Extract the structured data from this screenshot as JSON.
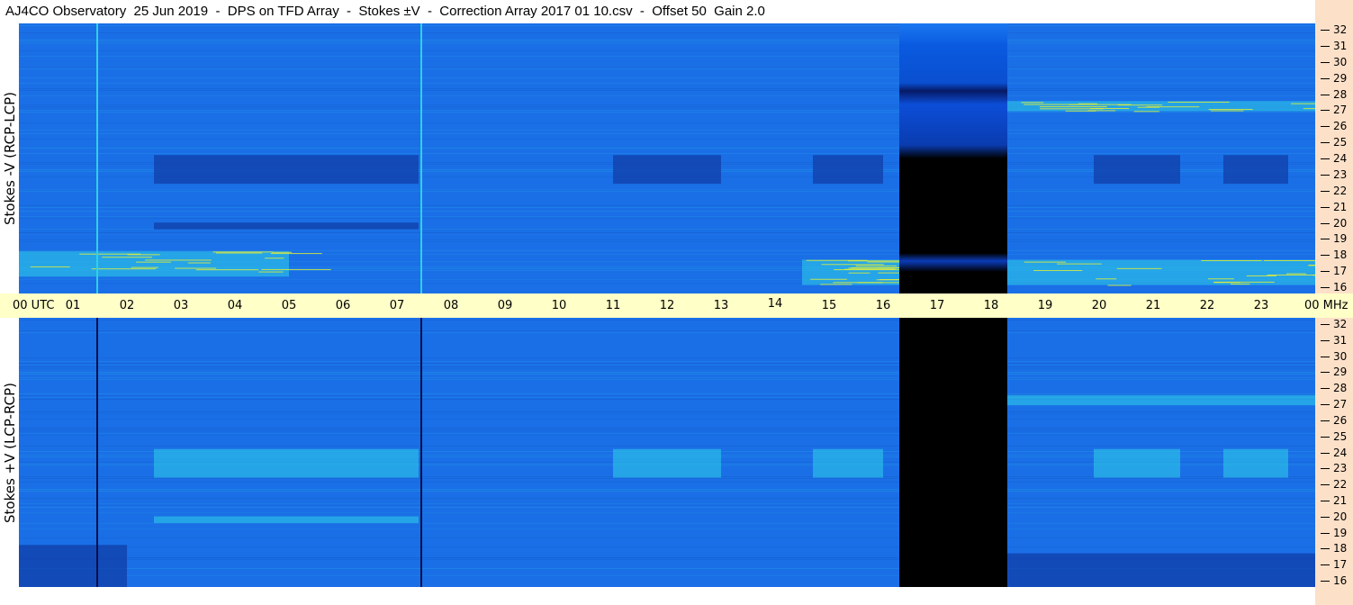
{
  "title": "AJ4CO Observatory  25 Jun 2019  -  DPS on TFD Array  -  Stokes ±V  -  Correction Array 2017 01 10.csv  -  Offset 50  Gain 2.0",
  "chart_data": [
    {
      "type": "heatmap",
      "panel": "top",
      "ylabel": "Stokes -V (RCP-LCP)",
      "x_range_utc_hours": [
        0,
        24
      ],
      "y_range_mhz": [
        16,
        32
      ],
      "y_ticks": [
        "32",
        "31",
        "30",
        "29",
        "28",
        "27",
        "26",
        "25",
        "24",
        "23",
        "22",
        "21",
        "20",
        "19",
        "18",
        "17",
        "16"
      ],
      "data_gap_utc": [
        16.3,
        18.3
      ],
      "vertical_lines_utc": [
        1.45,
        7.45
      ],
      "features": [
        {
          "kind": "dark-band",
          "x": [
            2.5,
            7.4
          ],
          "y": [
            22.5,
            24.2
          ]
        },
        {
          "kind": "dark-band",
          "x": [
            11.0,
            13.0
          ],
          "y": [
            22.5,
            24.2
          ]
        },
        {
          "kind": "dark-band",
          "x": [
            14.7,
            16.0
          ],
          "y": [
            22.5,
            24.2
          ]
        },
        {
          "kind": "dark-band",
          "x": [
            19.9,
            21.5
          ],
          "y": [
            22.5,
            24.2
          ]
        },
        {
          "kind": "dark-band",
          "x": [
            22.3,
            23.5
          ],
          "y": [
            22.5,
            24.2
          ]
        },
        {
          "kind": "dark-band",
          "x": [
            2.5,
            7.4
          ],
          "y": [
            19.8,
            20.2
          ]
        },
        {
          "kind": "bright-band",
          "x": [
            0,
            5
          ],
          "y": [
            17,
            18.5
          ]
        },
        {
          "kind": "bright-band",
          "x": [
            14.5,
            16.3
          ],
          "y": [
            16.5,
            18
          ]
        },
        {
          "kind": "bright-band",
          "x": [
            18.3,
            24
          ],
          "y": [
            16.5,
            18
          ]
        },
        {
          "kind": "bright-band",
          "x": [
            18.3,
            24
          ],
          "y": [
            26.8,
            27.4
          ]
        }
      ]
    },
    {
      "type": "heatmap",
      "panel": "bottom",
      "ylabel": "Stokes +V (LCP-RCP)",
      "x_range_utc_hours": [
        0,
        24
      ],
      "y_range_mhz": [
        16,
        32
      ],
      "y_ticks": [
        "32",
        "31",
        "30",
        "29",
        "28",
        "27",
        "26",
        "25",
        "24",
        "23",
        "22",
        "21",
        "20",
        "19",
        "18",
        "17",
        "16"
      ],
      "data_gap_utc": [
        16.3,
        18.3
      ],
      "vertical_lines_utc": [
        1.45,
        7.45
      ],
      "features": [
        {
          "kind": "bright-band",
          "x": [
            2.5,
            7.4
          ],
          "y": [
            22.5,
            24.2
          ]
        },
        {
          "kind": "bright-band",
          "x": [
            11.0,
            13.0
          ],
          "y": [
            22.5,
            24.2
          ]
        },
        {
          "kind": "bright-band",
          "x": [
            14.7,
            16.0
          ],
          "y": [
            22.5,
            24.2
          ]
        },
        {
          "kind": "bright-band",
          "x": [
            19.9,
            21.5
          ],
          "y": [
            22.5,
            24.2
          ]
        },
        {
          "kind": "bright-band",
          "x": [
            22.3,
            23.5
          ],
          "y": [
            22.5,
            24.2
          ]
        },
        {
          "kind": "bright-band",
          "x": [
            2.5,
            7.4
          ],
          "y": [
            19.8,
            20.2
          ]
        },
        {
          "kind": "bright-band",
          "x": [
            18.3,
            24
          ],
          "y": [
            26.8,
            27.4
          ]
        },
        {
          "kind": "dark-band",
          "x": [
            0,
            2
          ],
          "y": [
            16,
            18.5
          ]
        },
        {
          "kind": "dark-band",
          "x": [
            18.3,
            24
          ],
          "y": [
            16,
            18
          ]
        }
      ]
    }
  ],
  "time_axis": {
    "labels": [
      "00  UTC",
      "01",
      "02",
      "03",
      "04",
      "05",
      "06",
      "07",
      "08",
      "09",
      "10",
      "11",
      "12",
      "13",
      "14",
      "15",
      "16",
      "17",
      "18",
      "19",
      "20",
      "21",
      "22",
      "23",
      "00 MHz"
    ]
  },
  "colors": {
    "background": "#1a6fe6",
    "dark_band": "#103ea8",
    "bright": "#2fd0e8",
    "hot": "#e8f030",
    "gap": "#000000",
    "axis_bg": "#ffffc8",
    "right_strip": "#fde0c8"
  }
}
